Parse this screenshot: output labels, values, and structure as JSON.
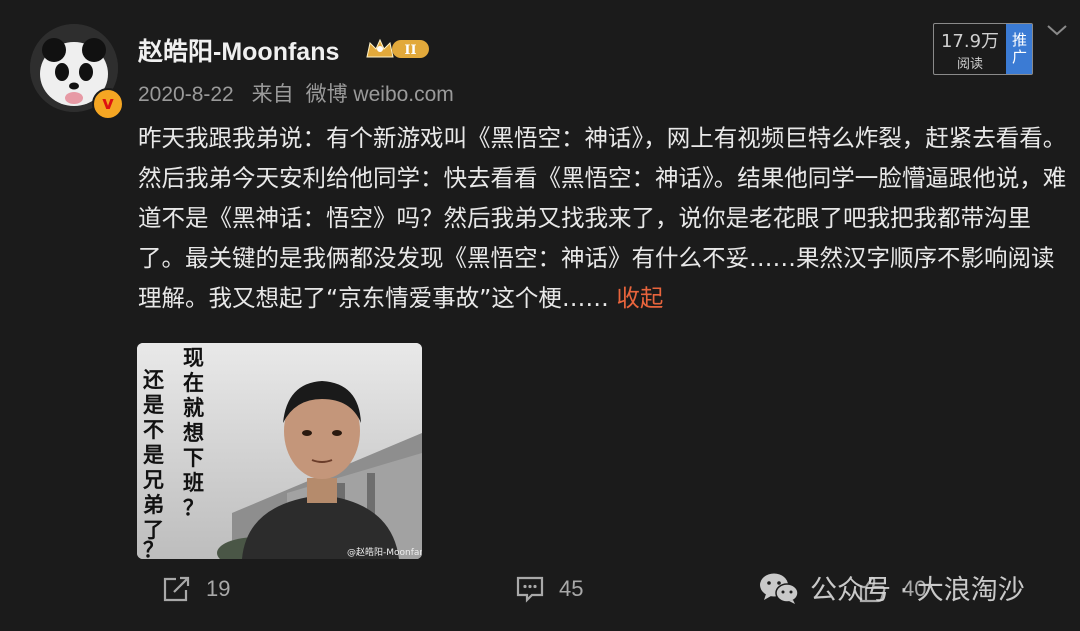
{
  "post": {
    "author": "赵皓阳-Moonfans",
    "date": "2020-8-22",
    "source_prefix": "来自",
    "source": "微博 weibo.com",
    "read_count": "17.9万",
    "read_label": "阅读",
    "promote_label": "推广",
    "verified_mark": "v",
    "level_badge": "II",
    "text": "昨天我跟我弟说：有个新游戏叫《黑悟空：神话》，网上有视频巨特么炸裂，赶紧去看看。然后我弟今天安利给他同学：快去看看《黑悟空：神话》。结果他同学一脸懵逼跟他说，难道不是《黑神话：悟空》吗？然后我弟又找我来了，说你是老花眼了吧我把我都带沟里了。最关键的是我俩都没发现《黑悟空：神话》有什么不妥……果然汉字顺序不影响阅读理解。我又想起了“京东情爱事故”这个梗……",
    "collapse_label": "收起"
  },
  "image": {
    "text_right": "现在就想下班？",
    "text_left": "还是不是兄弟了？",
    "watermark": "@赵皓阳-Moonfans"
  },
  "actions": {
    "share_count": "19",
    "comment_count": "45",
    "like_count": "40"
  },
  "watermark": {
    "label": "公众号 · 大浪淘沙"
  },
  "colors": {
    "background": "#1b1b1b",
    "accent": "#e8643c",
    "promote": "#3b7bd4"
  }
}
